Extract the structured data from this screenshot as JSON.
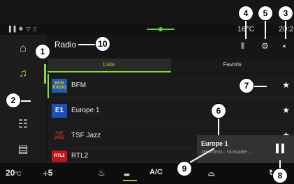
{
  "status": {
    "icons": "▐▐ ✱ ▽ ▯",
    "temperature": "16°C",
    "time": "20:2"
  },
  "sidebar": {
    "items": [
      {
        "name": "home",
        "glyph": "⌂"
      },
      {
        "name": "music",
        "glyph": "♫"
      },
      {
        "name": "apps",
        "glyph": "☷"
      },
      {
        "name": "car",
        "glyph": "▤"
      }
    ]
  },
  "header": {
    "title": "Radio",
    "equalizer_glyph": "⫴",
    "settings_glyph": "⚙",
    "source_glyph": "▪"
  },
  "tabs": [
    {
      "label": "Liste",
      "active": true
    },
    {
      "label": "Favoris",
      "active": false
    }
  ],
  "stations": [
    {
      "name": "BFM",
      "logo": "BFM RADIO",
      "logo_bg": "#1a5fb4",
      "logo_fg": "#f5c400",
      "favorite": true
    },
    {
      "name": "Europe 1",
      "logo": "E1",
      "logo_bg": "#1d4fb8",
      "logo_fg": "#ffffff",
      "favorite": true
    },
    {
      "name": "TSF Jazz",
      "logo": "TSF JAZZ",
      "logo_bg": "#1b1b1b",
      "logo_fg": "#d93a3a",
      "favorite": true
    },
    {
      "name": "RTL2",
      "logo": "RTL2",
      "logo_bg": "#c0161b",
      "logo_fg": "#ffffff",
      "favorite": false
    }
  ],
  "now_playing": {
    "station": "Europe 1",
    "info": "2H d'infos : l'actualité ..."
  },
  "bottom_bar": {
    "temp_left": "20",
    "temp_left_unit": "°C",
    "fan": "5",
    "ac_label": "A/C"
  },
  "callouts": [
    "1",
    "2",
    "3",
    "4",
    "5",
    "6",
    "7",
    "8",
    "9",
    "10"
  ],
  "colors": {
    "accent": "#8bd93a",
    "background": "#161616"
  }
}
